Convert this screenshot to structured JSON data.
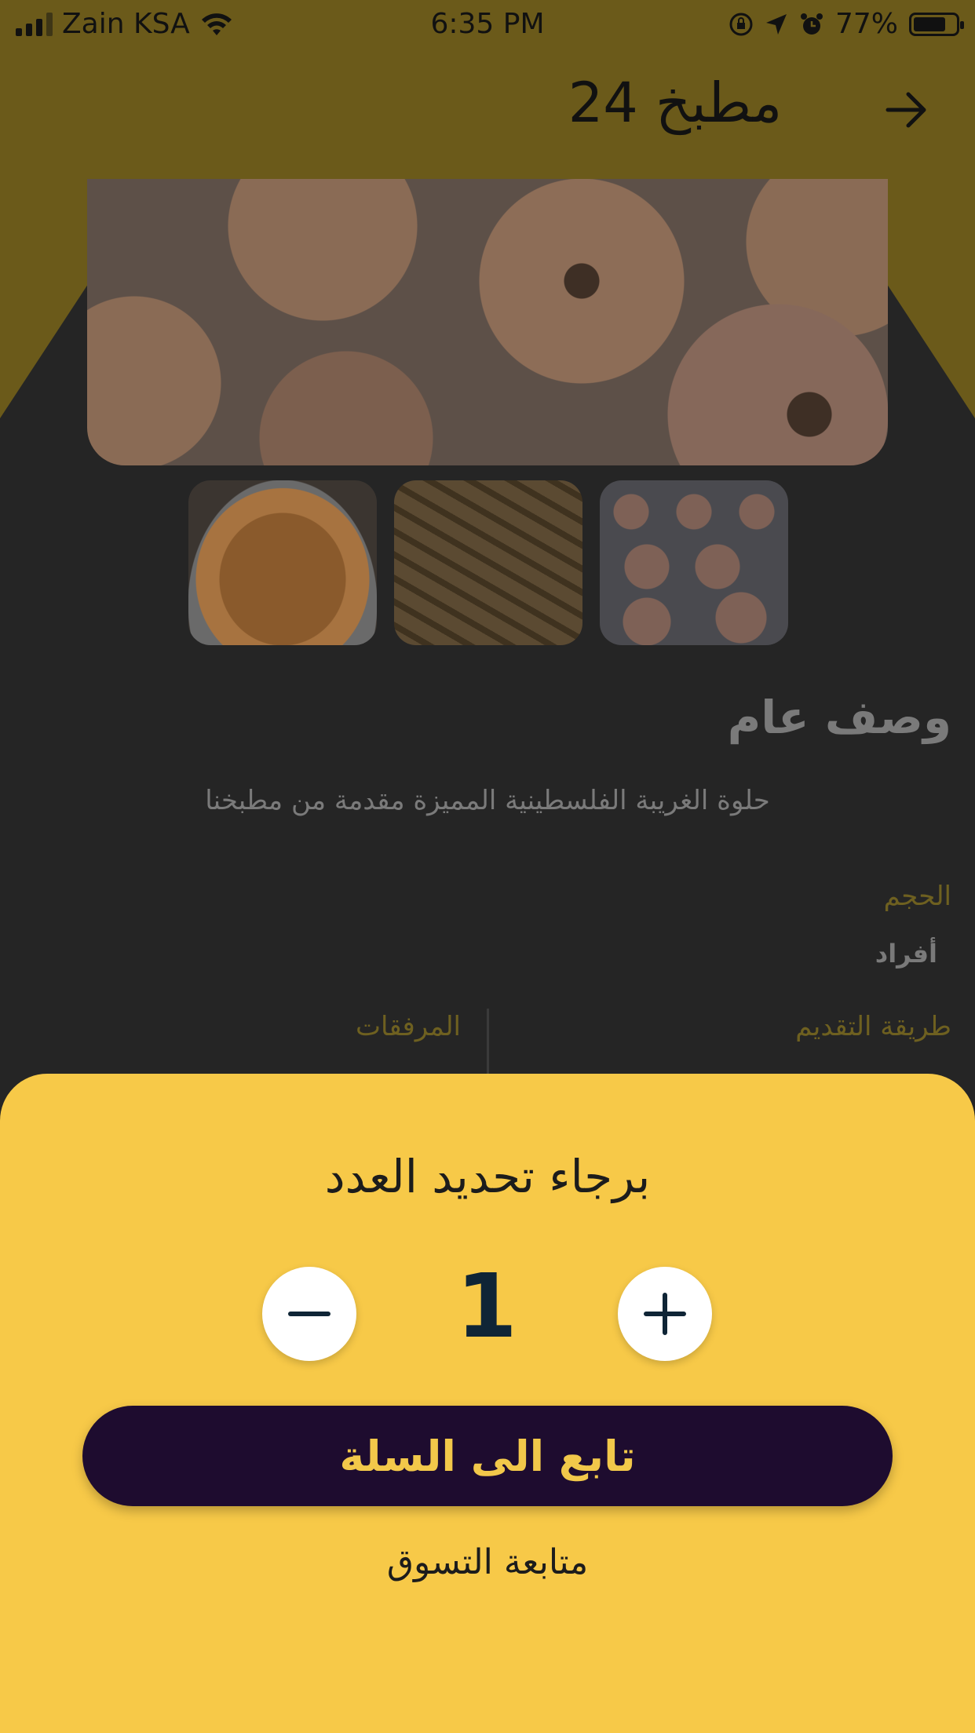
{
  "status_bar": {
    "carrier": "Zain KSA",
    "time": "6:35 PM",
    "battery": "77%",
    "battery_level": 0.77,
    "icons": [
      "signal-icon",
      "wifi-icon",
      "orientation-lock-icon",
      "location-icon",
      "alarm-icon",
      "battery-icon"
    ]
  },
  "header": {
    "title": "مطبخ 24",
    "back_icon": "arrow-right-icon"
  },
  "gallery": {
    "main_image": "maamoul-cookies-image",
    "thumbnails": [
      "samosa-pastries-image",
      "baklava-squares-image",
      "maamoul-cookies-image"
    ]
  },
  "details": {
    "section_title": "وصف عام",
    "description": "حلوة الغريبة الفلسطينية المميزة مقدمة من مطبخنا",
    "size_label": "الحجم",
    "size_value": "أفراد",
    "serving_label": "طريقة التقديم",
    "accessories_label": "المرفقات"
  },
  "sheet": {
    "title": "برجاء تحديد العدد",
    "quantity": "1",
    "minus_icon": "minus-icon",
    "plus_icon": "plus-icon",
    "cart_button": "تابع الى السلة",
    "continue_shopping": "متابعة التسوق"
  },
  "colors": {
    "header_overlay": "#6b5a1a",
    "sheet_background": "#f7c948",
    "cart_button": "#1e0c2f",
    "cart_button_text": "#f2c84a"
  }
}
